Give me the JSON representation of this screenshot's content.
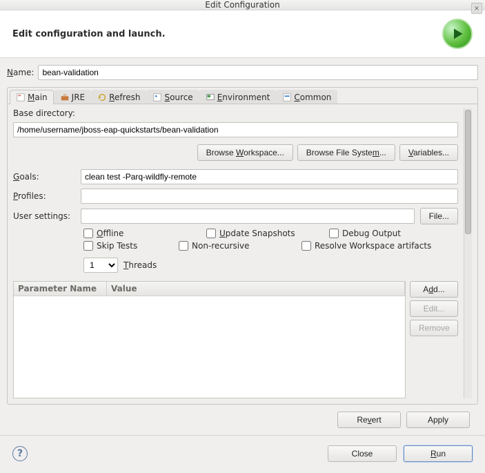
{
  "window": {
    "title": "Edit Configuration",
    "close_glyph": "×"
  },
  "header": {
    "title": "Edit configuration and launch."
  },
  "name": {
    "label": "Name:",
    "label_u": "N",
    "value": "bean-validation"
  },
  "tabs": {
    "main": "Main",
    "main_u": "M",
    "jre": "JRE",
    "refresh": "Refresh",
    "refresh_u": "R",
    "source": "Source",
    "source_u": "S",
    "environment": "Environment",
    "environment_u": "E",
    "common": "Common",
    "common_u": "C"
  },
  "main": {
    "base_dir_label": "Base directory:",
    "base_dir_value": "/home/username/jboss-eap-quickstarts/bean-validation",
    "browse_workspace": "Browse Workspace...",
    "browse_workspace_u": "W",
    "browse_fs": "Browse File System...",
    "browse_fs_u": "m",
    "variables": "Variables...",
    "variables_u": "V",
    "goals_label": "Goals:",
    "goals_u": "G",
    "goals_value": "clean test -Parq-wildfly-remote",
    "profiles_label": "Profiles:",
    "profiles_u": "P",
    "profiles_value": "",
    "usersettings_label": "User settings:",
    "usersettings_value": "",
    "file_btn": "File...",
    "chk_offline": "Offline",
    "chk_offline_u": "O",
    "chk_update": "Update Snapshots",
    "chk_update_u": "U",
    "chk_debug": "Debug Output",
    "chk_skip": "Skip Tests",
    "chk_nonrec": "Non-recursive",
    "chk_resolve": "Resolve Workspace artifacts",
    "threads_value": "1",
    "threads_label": "Threads",
    "threads_u": "T",
    "col_param": "Parameter Name",
    "col_value": "Value",
    "btn_add": "Add...",
    "btn_add_u": "d",
    "btn_edit": "Edit...",
    "btn_remove": "Remove"
  },
  "footer": {
    "revert": "Revert",
    "revert_u": "v",
    "apply": "Apply"
  },
  "bottom": {
    "help": "?",
    "close": "Close",
    "run": "Run",
    "run_u": "R"
  }
}
